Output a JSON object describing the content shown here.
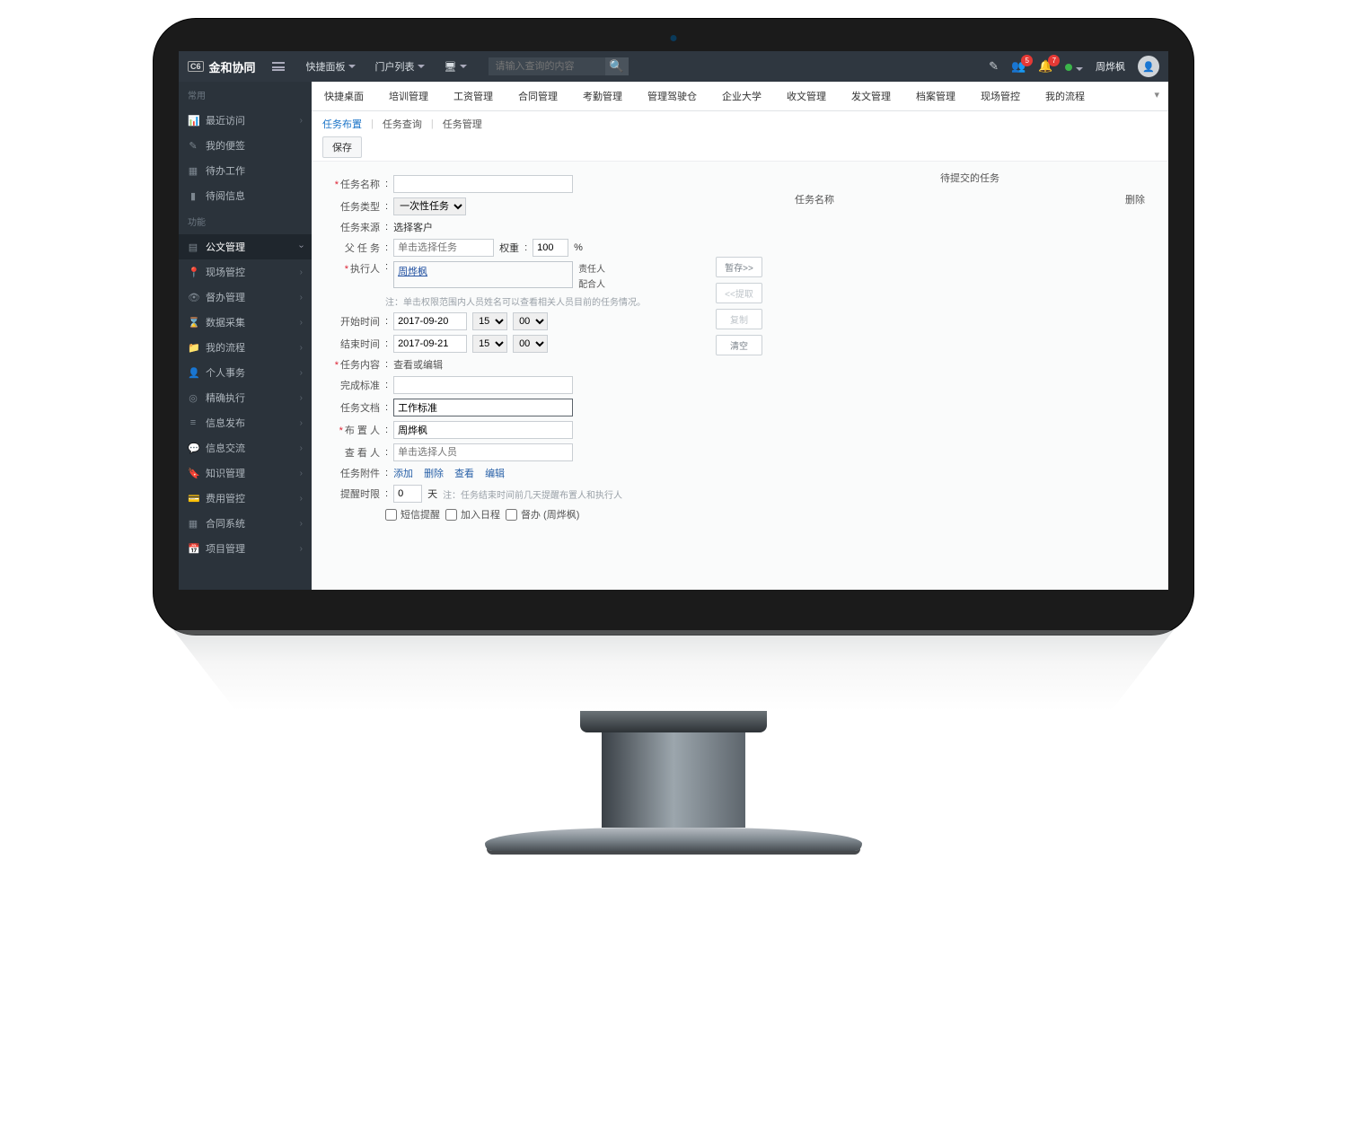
{
  "brand": {
    "prefix": "C6",
    "name": "金和协同"
  },
  "top_links": [
    "快捷面板",
    "门户列表"
  ],
  "search_placeholder": "请输入查询的内容",
  "badges": {
    "users": "5",
    "bell": "7"
  },
  "username": "周烨枫",
  "sidebar": {
    "sec1": "常用",
    "items1": [
      "最近访问",
      "我的便签",
      "待办工作",
      "待阅信息"
    ],
    "sec2": "功能",
    "items2": [
      "公文管理",
      "现场管控",
      "督办管理",
      "数据采集",
      "我的流程",
      "个人事务",
      "精确执行",
      "信息发布",
      "信息交流",
      "知识管理",
      "费用管控",
      "合同系统",
      "项目管理"
    ]
  },
  "primary_tabs": [
    "快捷桌面",
    "培训管理",
    "工资管理",
    "合同管理",
    "考勤管理",
    "管理驾驶仓",
    "企业大学",
    "收文管理",
    "发文管理",
    "档案管理",
    "现场管控",
    "我的流程"
  ],
  "secondary_tabs": [
    "任务布置",
    "任务查询",
    "任务管理"
  ],
  "save": "保存",
  "form": {
    "task_name": "任务名称",
    "task_type": "任务类型",
    "task_type_opt": "一次性任务",
    "task_source": "任务来源",
    "task_source_val": "选择客户",
    "parent": "父 任 务",
    "parent_ph": "单击选择任务",
    "weight": "权重",
    "weight_val": "100",
    "weight_unit": "%",
    "executor": "执行人",
    "executor_val": "周烨枫",
    "resp": "责任人",
    "coop": "配合人",
    "exec_note": "注：单击权限范围内人员姓名可以查看相关人员目前的任务情况。",
    "start": "开始时间",
    "start_date": "2017-09-20",
    "start_h": "15",
    "start_m": "00",
    "end": "结束时间",
    "end_date": "2017-09-21",
    "end_h": "15",
    "end_m": "00",
    "content": "任务内容",
    "content_link": "查看或编辑",
    "standard": "完成标准",
    "doc": "任务文档",
    "doc_val": "工作标准",
    "assigner": "布 置 人",
    "assigner_val": "周烨枫",
    "viewer": "查 看 人",
    "viewer_ph": "单击选择人员",
    "attach": "任务附件",
    "attach_add": "添加",
    "attach_del": "删除",
    "attach_view": "查看",
    "attach_edit": "编辑",
    "remind": "提醒时限",
    "remind_val": "0",
    "remind_unit": "天",
    "remind_note": "注：任务结束时间前几天提醒布置人和执行人",
    "cb_sms": "短信提醒",
    "cb_sched": "加入日程",
    "cb_superv": "督办 (周烨枫)"
  },
  "mid_btns": {
    "tmp": "暂存>>",
    "get": "<<提取",
    "copy": "复制",
    "clear": "清空"
  },
  "right": {
    "title": "待提交的任务",
    "col1": "任务名称",
    "col2": "删除"
  }
}
